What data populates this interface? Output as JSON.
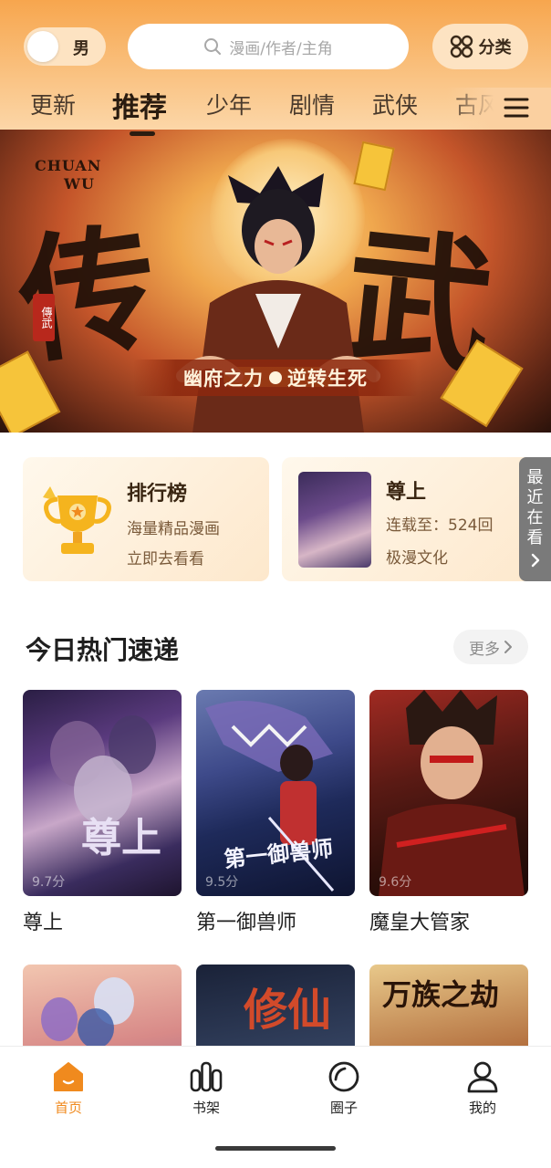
{
  "header": {
    "gender_label": "男",
    "search_placeholder": "漫画/作者/主角",
    "category_label": "分类"
  },
  "tabs": [
    {
      "label": "更新",
      "active": false
    },
    {
      "label": "推荐",
      "active": true
    },
    {
      "label": "少年",
      "active": false
    },
    {
      "label": "剧情",
      "active": false
    },
    {
      "label": "武侠",
      "active": false
    },
    {
      "label": "古风",
      "active": false
    }
  ],
  "banner": {
    "logo_text_1": "CHUAN",
    "logo_text_2": "WU",
    "title_glyph_left": "传",
    "title_glyph_right": "武",
    "seal_text": "傳武",
    "slogan_left": "幽府之力",
    "slogan_right": "逆转生死"
  },
  "cards": {
    "ranking": {
      "title": "排行榜",
      "line1": "海量精品漫画",
      "line2": "立即去看看"
    },
    "recent": {
      "title": "尊上",
      "line1": "连载至：524回",
      "line2": "极漫文化"
    },
    "recent_tab_label": [
      "最",
      "近",
      "在",
      "看"
    ]
  },
  "section": {
    "title": "今日热门速递",
    "more_label": "更多"
  },
  "comics": [
    {
      "name": "尊上",
      "score": "9.7分",
      "cover_glyph": "尊上"
    },
    {
      "name": "第一御兽师",
      "score": "9.5分",
      "cover_glyph": "第一御兽师"
    },
    {
      "name": "魔皇大管家",
      "score": "9.6分",
      "cover_glyph": ""
    },
    {
      "name": "",
      "score": "",
      "cover_glyph": ""
    },
    {
      "name": "",
      "score": "",
      "cover_glyph": "修仙"
    },
    {
      "name": "",
      "score": "",
      "cover_glyph": "万族之劫"
    }
  ],
  "bottom_nav": [
    {
      "label": "首页",
      "icon": "home-icon",
      "active": true
    },
    {
      "label": "书架",
      "icon": "bookshelf-icon",
      "active": false
    },
    {
      "label": "圈子",
      "icon": "circle-icon",
      "active": false
    },
    {
      "label": "我的",
      "icon": "profile-icon",
      "active": false
    }
  ],
  "colors": {
    "accent": "#f08a1e",
    "header_top": "#f7a64e",
    "header_bottom": "#fcd9ad"
  }
}
